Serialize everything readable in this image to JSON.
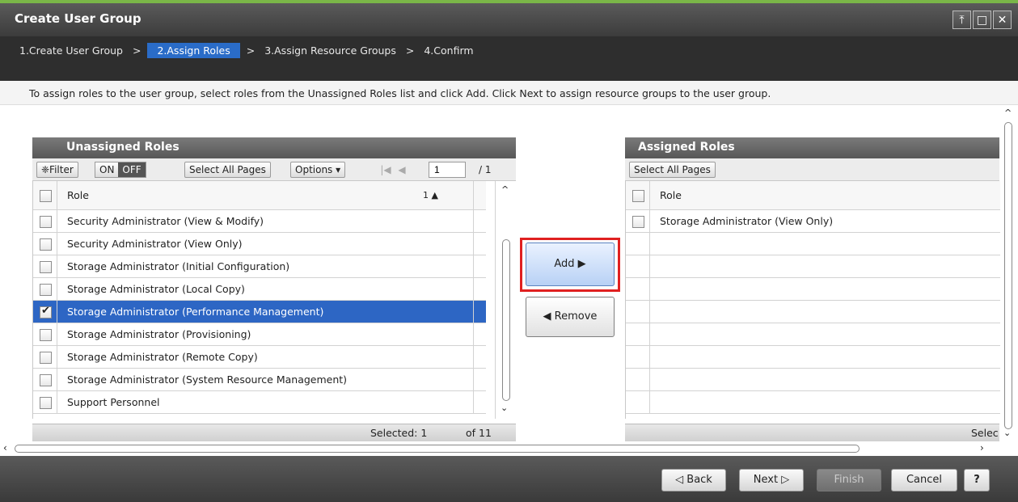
{
  "window": {
    "title": "Create User Group"
  },
  "steps": [
    {
      "label": "1.Create User Group"
    },
    {
      "label": "2.Assign Roles"
    },
    {
      "label": "3.Assign Resource Groups"
    },
    {
      "label": "4.Confirm"
    }
  ],
  "step_separator": ">",
  "instructions": "To assign roles to the user group, select roles from the Unassigned Roles list and click Add. Click Next to assign resource groups to the user group.",
  "unassigned": {
    "title": "Unassigned Roles",
    "filter_label": "❈Filter",
    "on_label": "ON",
    "off_label": "OFF",
    "select_all_pages": "Select All Pages",
    "options_label": "Options ▾",
    "page_value": "1",
    "page_total": "/ 1",
    "column_header": "Role",
    "sort_indicator": "1 ▲",
    "rows": [
      {
        "label": "Security Administrator (View & Modify)",
        "checked": false
      },
      {
        "label": "Security Administrator (View Only)",
        "checked": false
      },
      {
        "label": "Storage Administrator (Initial Configuration)",
        "checked": false
      },
      {
        "label": "Storage Administrator (Local Copy)",
        "checked": false
      },
      {
        "label": "Storage Administrator (Performance Management)",
        "checked": true
      },
      {
        "label": "Storage Administrator (Provisioning)",
        "checked": false
      },
      {
        "label": "Storage Administrator (Remote Copy)",
        "checked": false
      },
      {
        "label": "Storage Administrator (System Resource Management)",
        "checked": false
      },
      {
        "label": "Support Personnel",
        "checked": false
      }
    ],
    "selected_text": "Selected:  1",
    "of_text": "of  11"
  },
  "assigned": {
    "title": "Assigned Roles",
    "select_all_pages": "Select All Pages",
    "column_header": "Role",
    "rows": [
      {
        "label": "Storage Administrator (View Only)",
        "checked": false
      }
    ],
    "selected_text": "Selec"
  },
  "buttons": {
    "add": "Add ▶",
    "remove": "◀ Remove",
    "back": "◁ Back",
    "next": "Next ▷",
    "finish": "Finish",
    "cancel": "Cancel",
    "help": "?"
  },
  "icons": {
    "pin": "⤒",
    "restore": "□",
    "close": "✕",
    "first_page": "|◀",
    "prev_page": "◀"
  }
}
